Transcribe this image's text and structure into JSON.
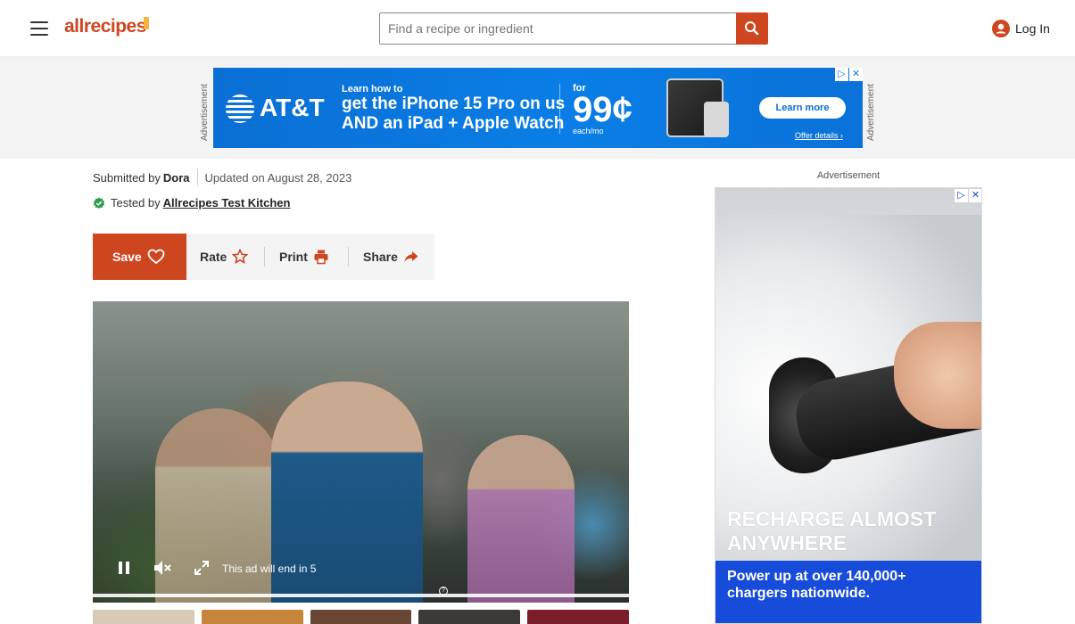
{
  "header": {
    "logo_text": "allrecipes",
    "search_placeholder": "Find a recipe or ingredient",
    "login_label": "Log In",
    "accent_color": "#ce4620"
  },
  "top_ad": {
    "side_label": "Advertisement",
    "brand": "AT&T",
    "small_line": "Learn how to",
    "main_line_1": "get the iPhone 15 Pro on us",
    "main_line_2": "AND an iPad + Apple Watch",
    "for_label": "for",
    "price": "99¢",
    "each_label": "each/mo",
    "cta_label": "Learn more",
    "offer_label": "Offer details ›"
  },
  "byline": {
    "submitted_prefix": "Submitted by",
    "author": "Dora",
    "updated": "Updated on August 28, 2023",
    "tested_prefix": "Tested by",
    "tester": "Allrecipes Test Kitchen"
  },
  "actions": {
    "save": "Save",
    "rate": "Rate",
    "print": "Print",
    "share": "Share"
  },
  "video": {
    "ad_end_text": "This ad will end in 5",
    "help_glyph": "?",
    "progress": 0.0
  },
  "right_ad": {
    "label": "Advertisement",
    "headline": "RECHARGE ALMOST ANYWHERE",
    "subtext": "Power up at over 140,000+ chargers nationwide."
  }
}
